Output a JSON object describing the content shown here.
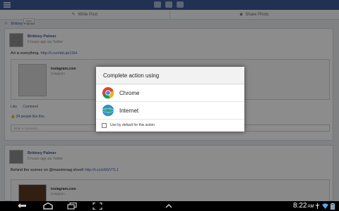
{
  "facebook": {
    "post_action_bar": {
      "write_post_label": "Write Post",
      "share_photo_label": "Share Photo"
    },
    "filter_breadcrumb": "Brittney Palmer",
    "mini_like_label": "Liked",
    "posts": [
      {
        "author": "Brittney Palmer",
        "meta": "5 hours ago via Twitter",
        "text": "Art is everything.",
        "link": "http://t.co/mbLqe1SH",
        "attachment_site": "instagram.com",
        "attachment_sub": "instagram",
        "like_label": "Like",
        "comment_label": "Comment",
        "likes_text": "34 people like this.",
        "comment_placeholder": "Write a comment..."
      },
      {
        "author": "Brittney Palmer",
        "meta": "5 hours ago via Twitter",
        "text": "Behind the scenes on @maximmag shoot!",
        "link": "http://t.co/z60rVTL1",
        "attachment_site": "instagram.com",
        "attachment_sub": "instagram"
      }
    ]
  },
  "dialog": {
    "title": "Complete action using",
    "options": [
      {
        "label": "Chrome",
        "icon": "chrome-icon"
      },
      {
        "label": "Internet",
        "icon": "internet-browser-icon"
      }
    ],
    "default_label": "Use by default for this action",
    "default_checked": false
  },
  "system_bar": {
    "time": "8:22",
    "ampm": "AM",
    "colors": {
      "background": "#000000",
      "text": "#ffffff"
    }
  },
  "colors": {
    "facebook_blue": "#3b5998",
    "feed_bg": "#e9ebee"
  }
}
